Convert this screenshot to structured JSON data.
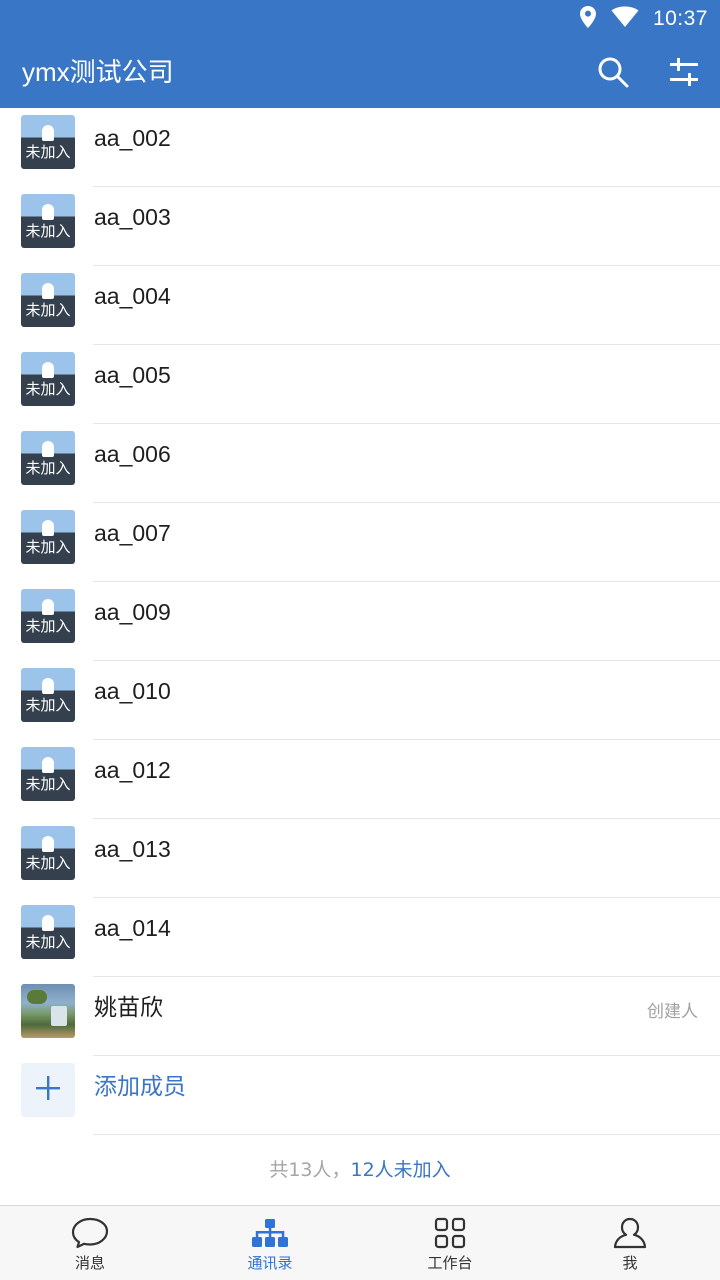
{
  "status_bar": {
    "time": "10:37",
    "icons": [
      "location-icon",
      "wifi-icon"
    ]
  },
  "header": {
    "title": "ymx测试公司",
    "actions": [
      "search-icon",
      "filter-icon"
    ]
  },
  "members": [
    {
      "name": "aa_002",
      "status": "未加入"
    },
    {
      "name": "aa_003",
      "status": "未加入"
    },
    {
      "name": "aa_004",
      "status": "未加入"
    },
    {
      "name": "aa_005",
      "status": "未加入"
    },
    {
      "name": "aa_006",
      "status": "未加入"
    },
    {
      "name": "aa_007",
      "status": "未加入"
    },
    {
      "name": "aa_009",
      "status": "未加入"
    },
    {
      "name": "aa_010",
      "status": "未加入"
    },
    {
      "name": "aa_012",
      "status": "未加入"
    },
    {
      "name": "aa_013",
      "status": "未加入"
    },
    {
      "name": "aa_014",
      "status": "未加入"
    }
  ],
  "creator": {
    "name": "姚苗欣",
    "role": "创建人"
  },
  "add_member": {
    "label": "添加成员"
  },
  "summary": {
    "total": "共13人，",
    "pending": "12人未加入"
  },
  "tabs": [
    {
      "label": "消息",
      "icon": "chat-icon",
      "active": false
    },
    {
      "label": "通讯录",
      "icon": "org-chart-icon",
      "active": true
    },
    {
      "label": "工作台",
      "icon": "grid-icon",
      "active": false
    },
    {
      "label": "我",
      "icon": "user-icon",
      "active": false
    }
  ],
  "colors": {
    "primary": "#3a76c6",
    "tab_active": "#2f73d6",
    "muted": "#a6a6a6"
  }
}
